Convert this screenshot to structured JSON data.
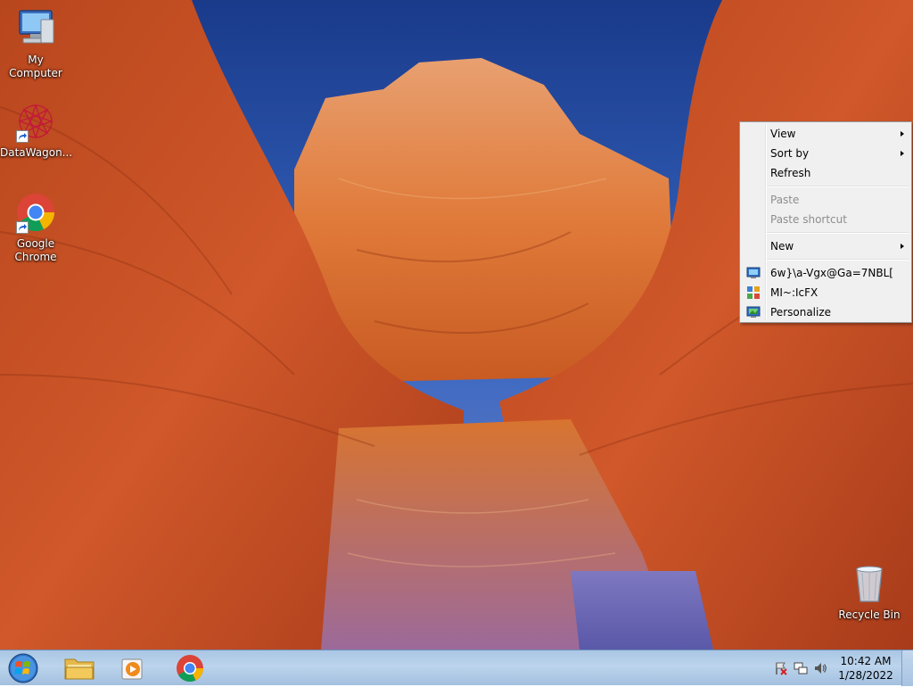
{
  "desktop": {
    "icons": [
      {
        "label": "My Computer",
        "icon": "computer-icon"
      },
      {
        "label": "DataWagon...",
        "icon": "datawagon-icon"
      },
      {
        "label": "Google Chrome",
        "icon": "chrome-icon"
      },
      {
        "label": "Recycle Bin",
        "icon": "recycle-bin-icon"
      }
    ]
  },
  "context_menu": {
    "items": [
      {
        "label": "View",
        "submenu": true,
        "enabled": true
      },
      {
        "label": "Sort by",
        "submenu": true,
        "enabled": true
      },
      {
        "label": "Refresh",
        "submenu": false,
        "enabled": true
      },
      {
        "label": "Paste",
        "submenu": false,
        "enabled": false
      },
      {
        "label": "Paste shortcut",
        "submenu": false,
        "enabled": false
      },
      {
        "label": "New",
        "submenu": true,
        "enabled": true
      },
      {
        "label": "6w}\\a-Vgx@Ga=7NBL[",
        "submenu": false,
        "enabled": true,
        "icon": "screen-resolution-icon"
      },
      {
        "label": "MI~:IcFX",
        "submenu": false,
        "enabled": true,
        "icon": "gadgets-icon"
      },
      {
        "label": "Personalize",
        "submenu": false,
        "enabled": true,
        "icon": "personalize-icon"
      }
    ]
  },
  "taskbar": {
    "pinned": [
      {
        "name": "Windows Explorer",
        "icon": "folder-icon"
      },
      {
        "name": "Windows Media Player",
        "icon": "media-player-icon"
      },
      {
        "name": "Google Chrome",
        "icon": "chrome-icon"
      }
    ],
    "clock": {
      "time": "10:42 AM",
      "date": "1/28/2022"
    }
  },
  "colors": {
    "sky": "#2c5cb8",
    "rock": "#c4501f",
    "taskbar": "#bcd4ec",
    "menu_bg": "#f0f0f0",
    "disabled_text": "#8d8d8d"
  }
}
